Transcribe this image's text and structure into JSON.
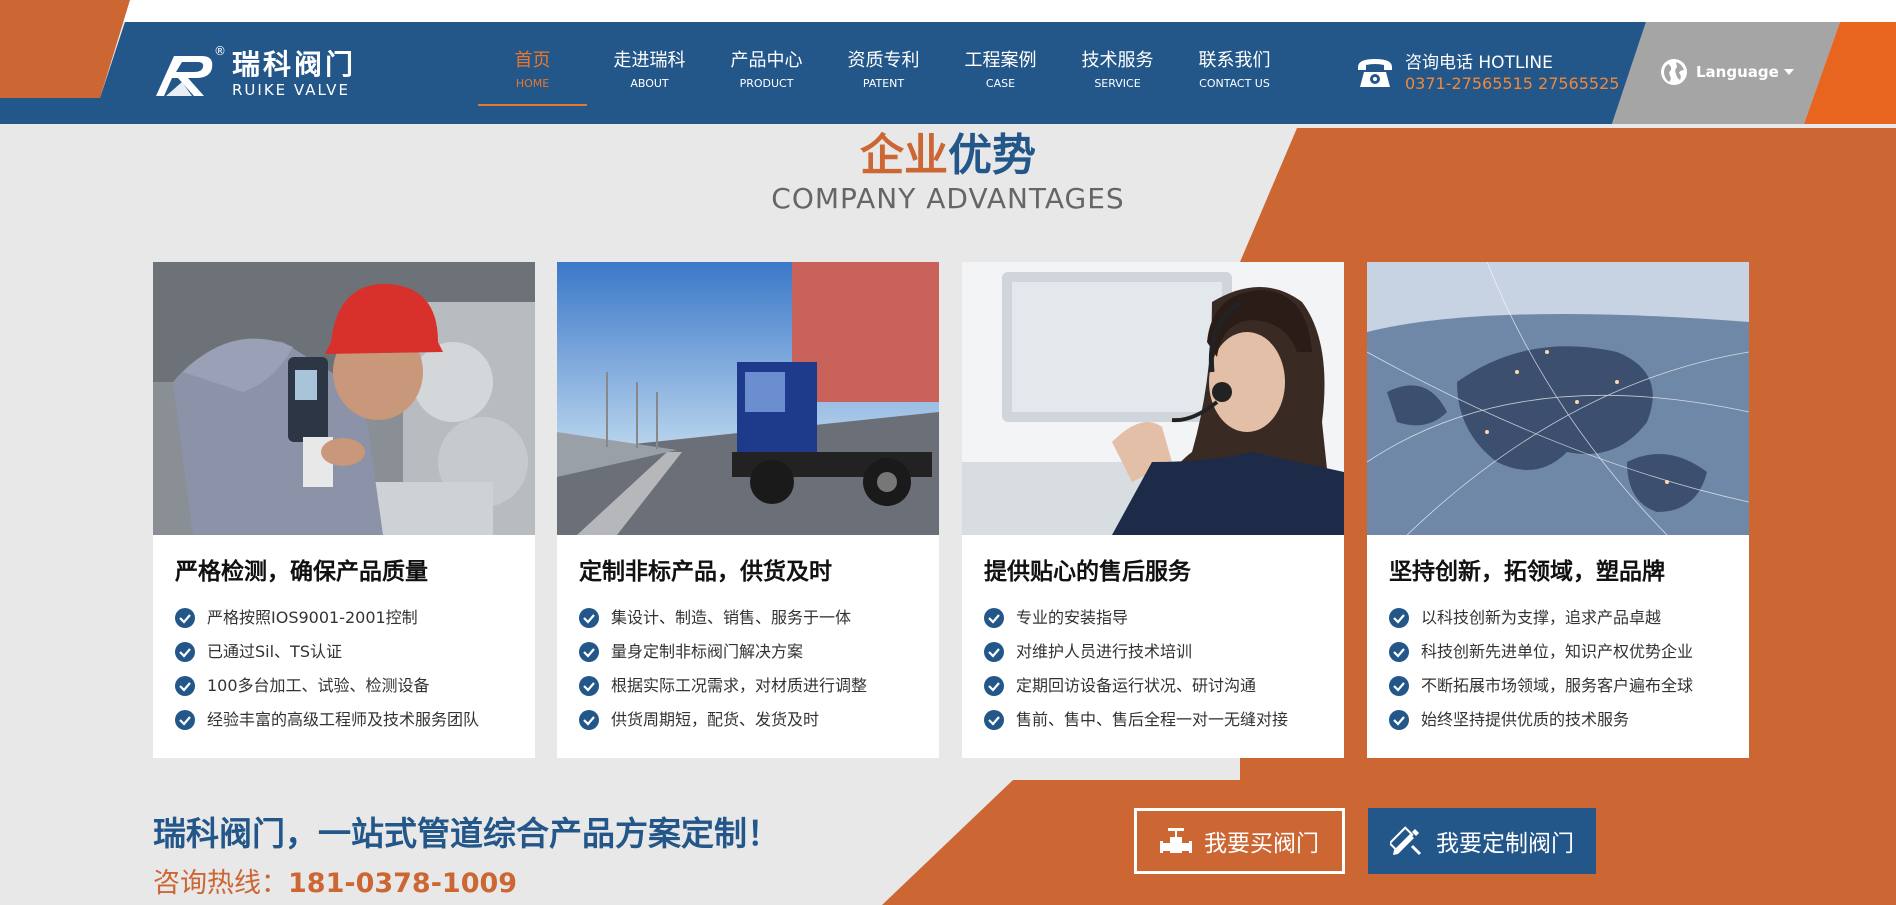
{
  "brand": {
    "name_cn": "瑞科阀门",
    "name_en": "RUIKE VALVE",
    "registered_mark": "®"
  },
  "nav": {
    "items": [
      {
        "cn": "首页",
        "en": "HOME",
        "active": true
      },
      {
        "cn": "走进瑞科",
        "en": "ABOUT",
        "active": false
      },
      {
        "cn": "产品中心",
        "en": "PRODUCT",
        "active": false
      },
      {
        "cn": "资质专利",
        "en": "PATENT",
        "active": false
      },
      {
        "cn": "工程案例",
        "en": "CASE",
        "active": false
      },
      {
        "cn": "技术服务",
        "en": "SERVICE",
        "active": false
      },
      {
        "cn": "联系我们",
        "en": "CONTACT US",
        "active": false
      }
    ]
  },
  "hotline": {
    "label": "咨询电话 HOTLINE",
    "numbers": "0371-27565515 27565525",
    "icon": "phone-icon"
  },
  "language": {
    "label": "Language",
    "icon": "globe-icon"
  },
  "section": {
    "title_part1": "企业",
    "title_part2": "优势",
    "subtitle": "COMPANY ADVANTAGES"
  },
  "cards": [
    {
      "title": "严格检测，确保产品质量",
      "image": "worker-inspection-photo",
      "items": [
        "严格按照IOS9001-2001控制",
        "已通过Sil、TS认证",
        "100多台加工、试验、检测设备",
        "经验丰富的高级工程师及技术服务团队"
      ]
    },
    {
      "title": "定制非标产品，供货及时",
      "image": "truck-highway-photo",
      "items": [
        "集设计、制造、销售、服务于一体",
        "量身定制非标阀门解决方案",
        "根据实际工况需求，对材质进行调整",
        "供货周期短，配货、发货及时"
      ]
    },
    {
      "title": "提供贴心的售后服务",
      "image": "customer-service-photo",
      "items": [
        "专业的安装指导",
        "对维护人员进行技术培训",
        "定期回访设备运行状况、研讨沟通",
        "售前、售中、售后全程一对一无缝对接"
      ]
    },
    {
      "title": "坚持创新，拓领域，塑品牌",
      "image": "world-map-network-photo",
      "items": [
        "以科技创新为支撑，追求产品卓越",
        "科技创新先进单位，知识产权优势企业",
        "不断拓展市场领域，服务客户遍布全球",
        "始终坚持提供优质的技术服务"
      ]
    }
  ],
  "bottom": {
    "slogan": "瑞科阀门，一站式管道综合产品方案定制！",
    "hotline_label": "咨询热线：",
    "hotline_number": "181-0378-1009",
    "buy_button": "我要买阀门",
    "custom_button": "我要定制阀门"
  },
  "colors": {
    "blue": "#23578a",
    "orange": "#cc6633",
    "accent_orange": "#e8772e",
    "gray": "#a5a5a5"
  }
}
